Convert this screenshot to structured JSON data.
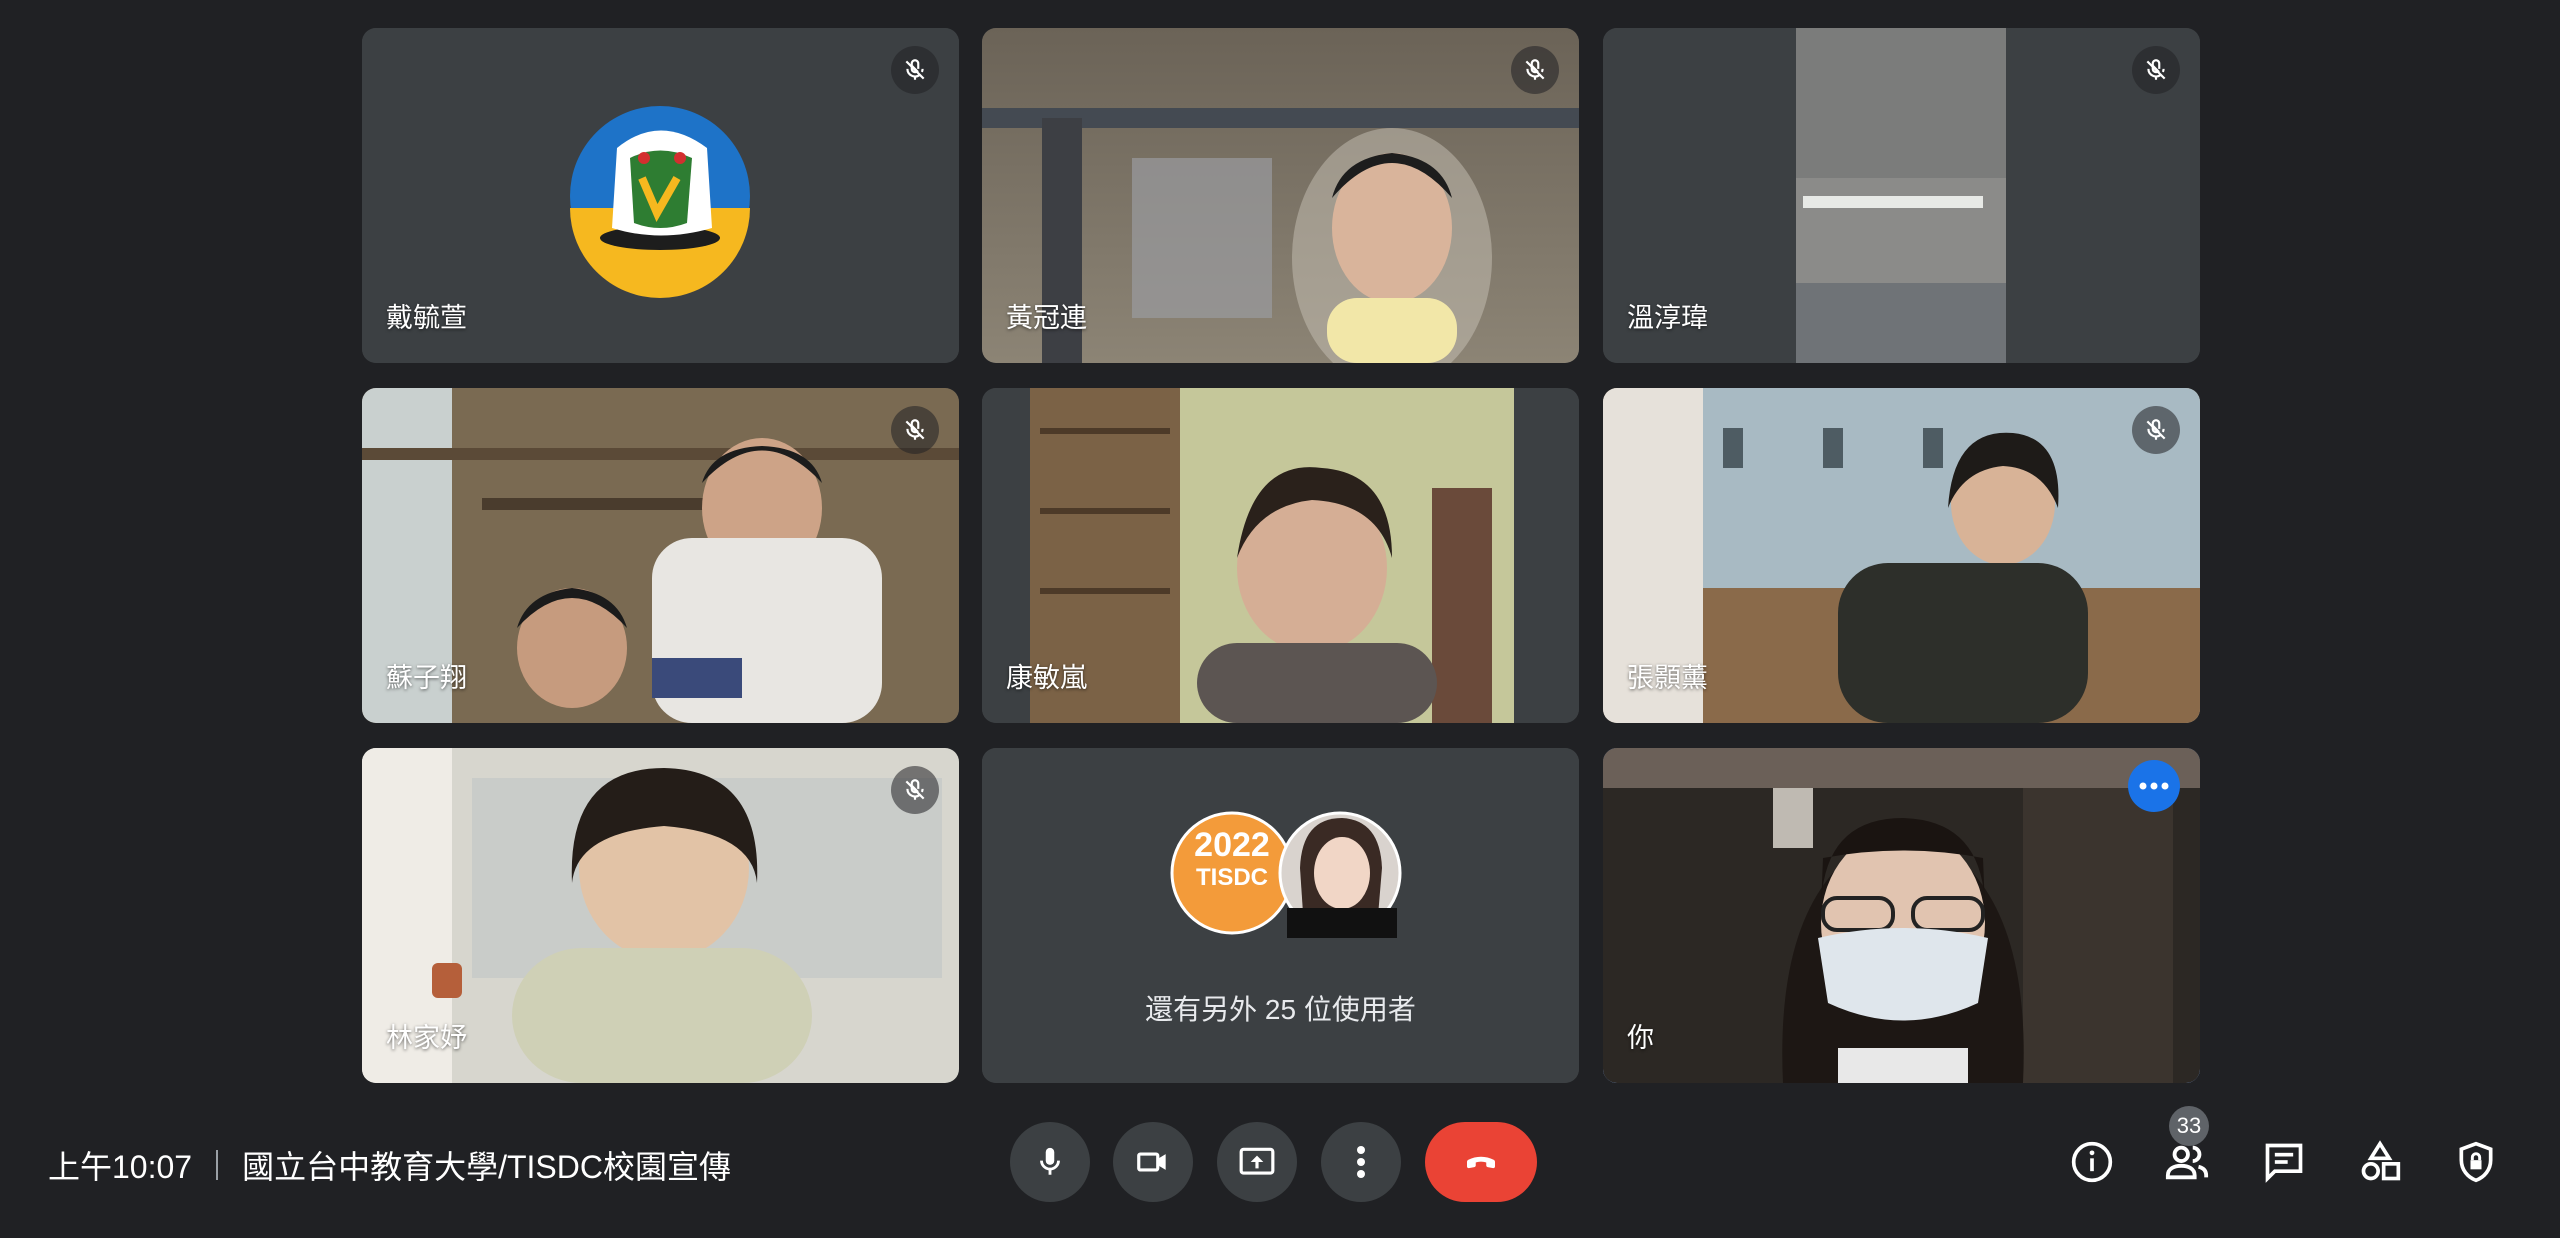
{
  "participants": [
    {
      "name": "戴毓萱",
      "muted": true
    },
    {
      "name": "黃冠連",
      "muted": true
    },
    {
      "name": "溫淳瑋",
      "muted": true
    },
    {
      "name": "蘇子翔",
      "muted": true
    },
    {
      "name": "康敏嵐",
      "muted": false
    },
    {
      "name": "張顥薰",
      "muted": true
    },
    {
      "name": "林家妤",
      "muted": true
    },
    {
      "name": "你",
      "muted": false
    }
  ],
  "others": {
    "avatar_text_line1": "2022",
    "avatar_text_line2": "TISDC",
    "label": "還有另外 25 位使用者"
  },
  "meeting": {
    "time": "上午10:07",
    "title": "國立台中教育大學/TISDC校園宣傳"
  },
  "controls": {
    "accent_end": "#ea4335",
    "accent_self": "#8ab4f8"
  },
  "people_count": "33"
}
